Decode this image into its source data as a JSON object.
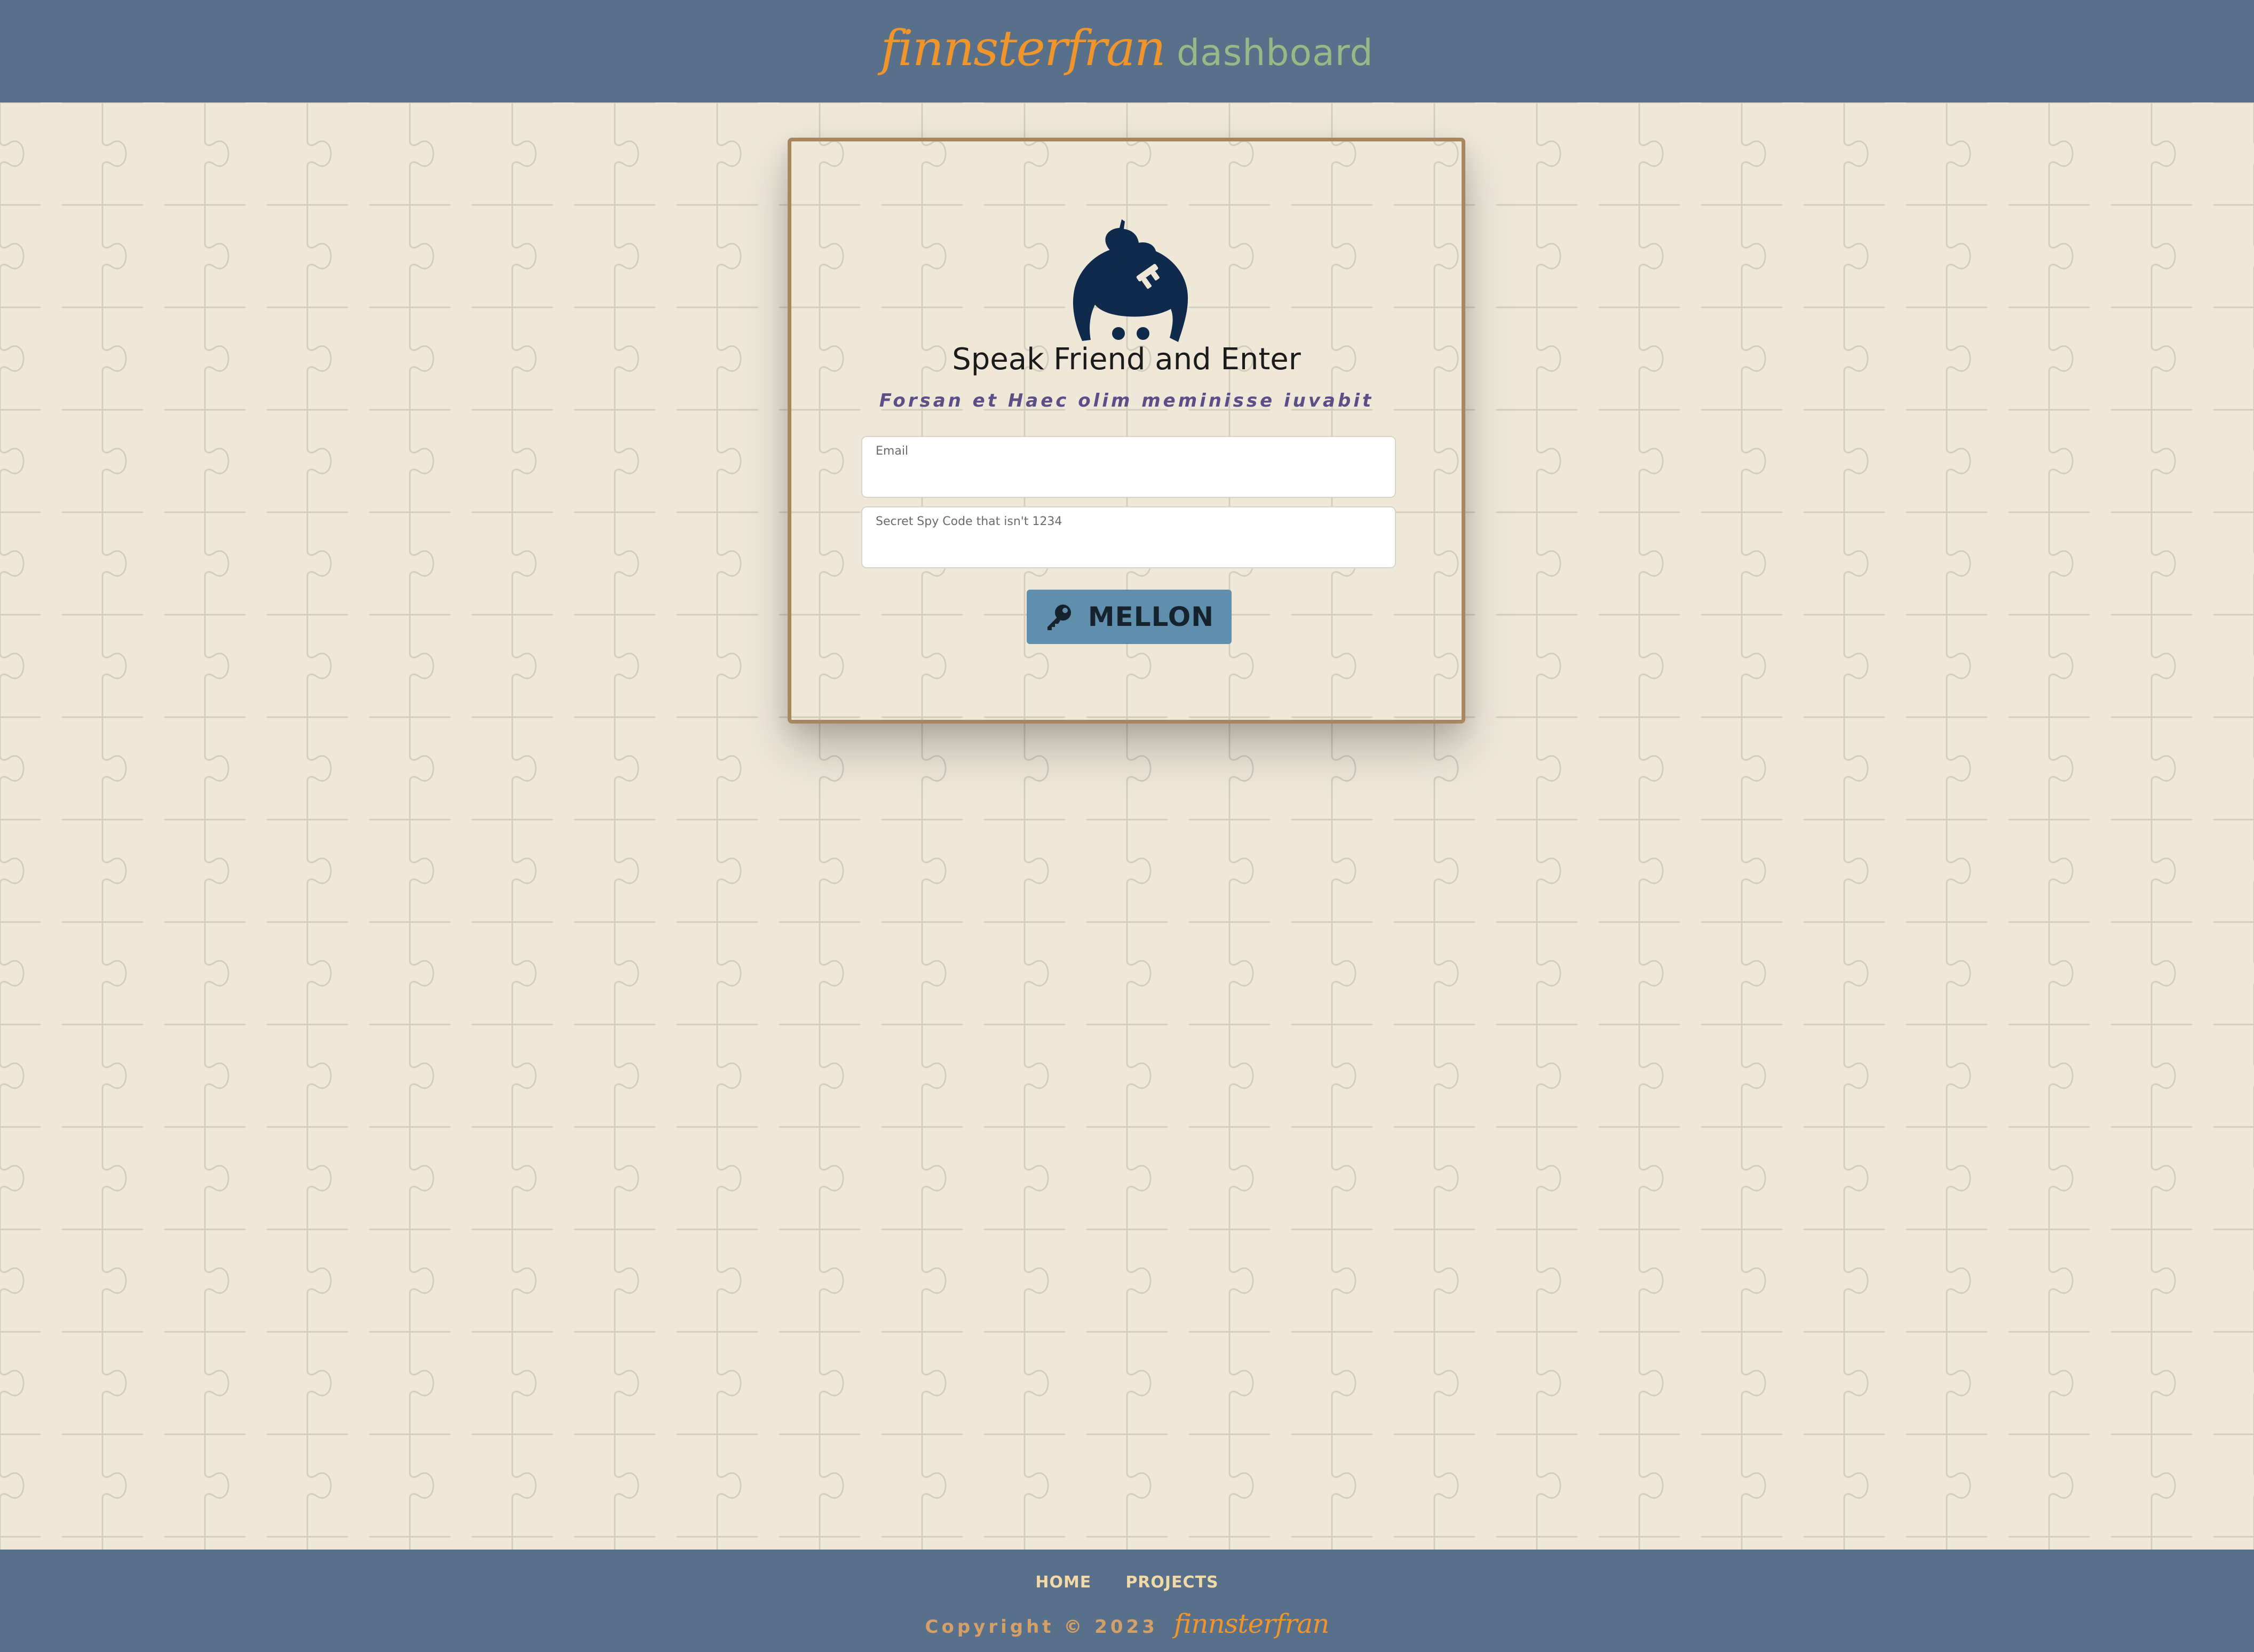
{
  "header": {
    "brand_script": "finnsterfran",
    "brand_word": "dashboard"
  },
  "login": {
    "title": "Speak Friend and Enter",
    "subtitle": "Forsan et Haec olim meminisse iuvabit",
    "email_label": "Email",
    "email_value": "",
    "code_label": "Secret Spy Code that isn't 1234",
    "code_value": "",
    "submit_label": "MELLON",
    "submit_icon": "key-icon",
    "logo_icon": "hooded-face-with-key-icon"
  },
  "footer": {
    "nav": [
      "HOME",
      "PROJECTS"
    ],
    "copyright": "Copyright © 2023",
    "brand": "finnsterfran"
  },
  "colors": {
    "bar": "#587089",
    "background": "#efe8d8",
    "card_border": "#a88760",
    "button": "#5f8fad",
    "brand_orange": "#f0952c",
    "brand_green": "#98b887",
    "subtitle": "#5c4e86",
    "logo": "#0f2a4a"
  }
}
